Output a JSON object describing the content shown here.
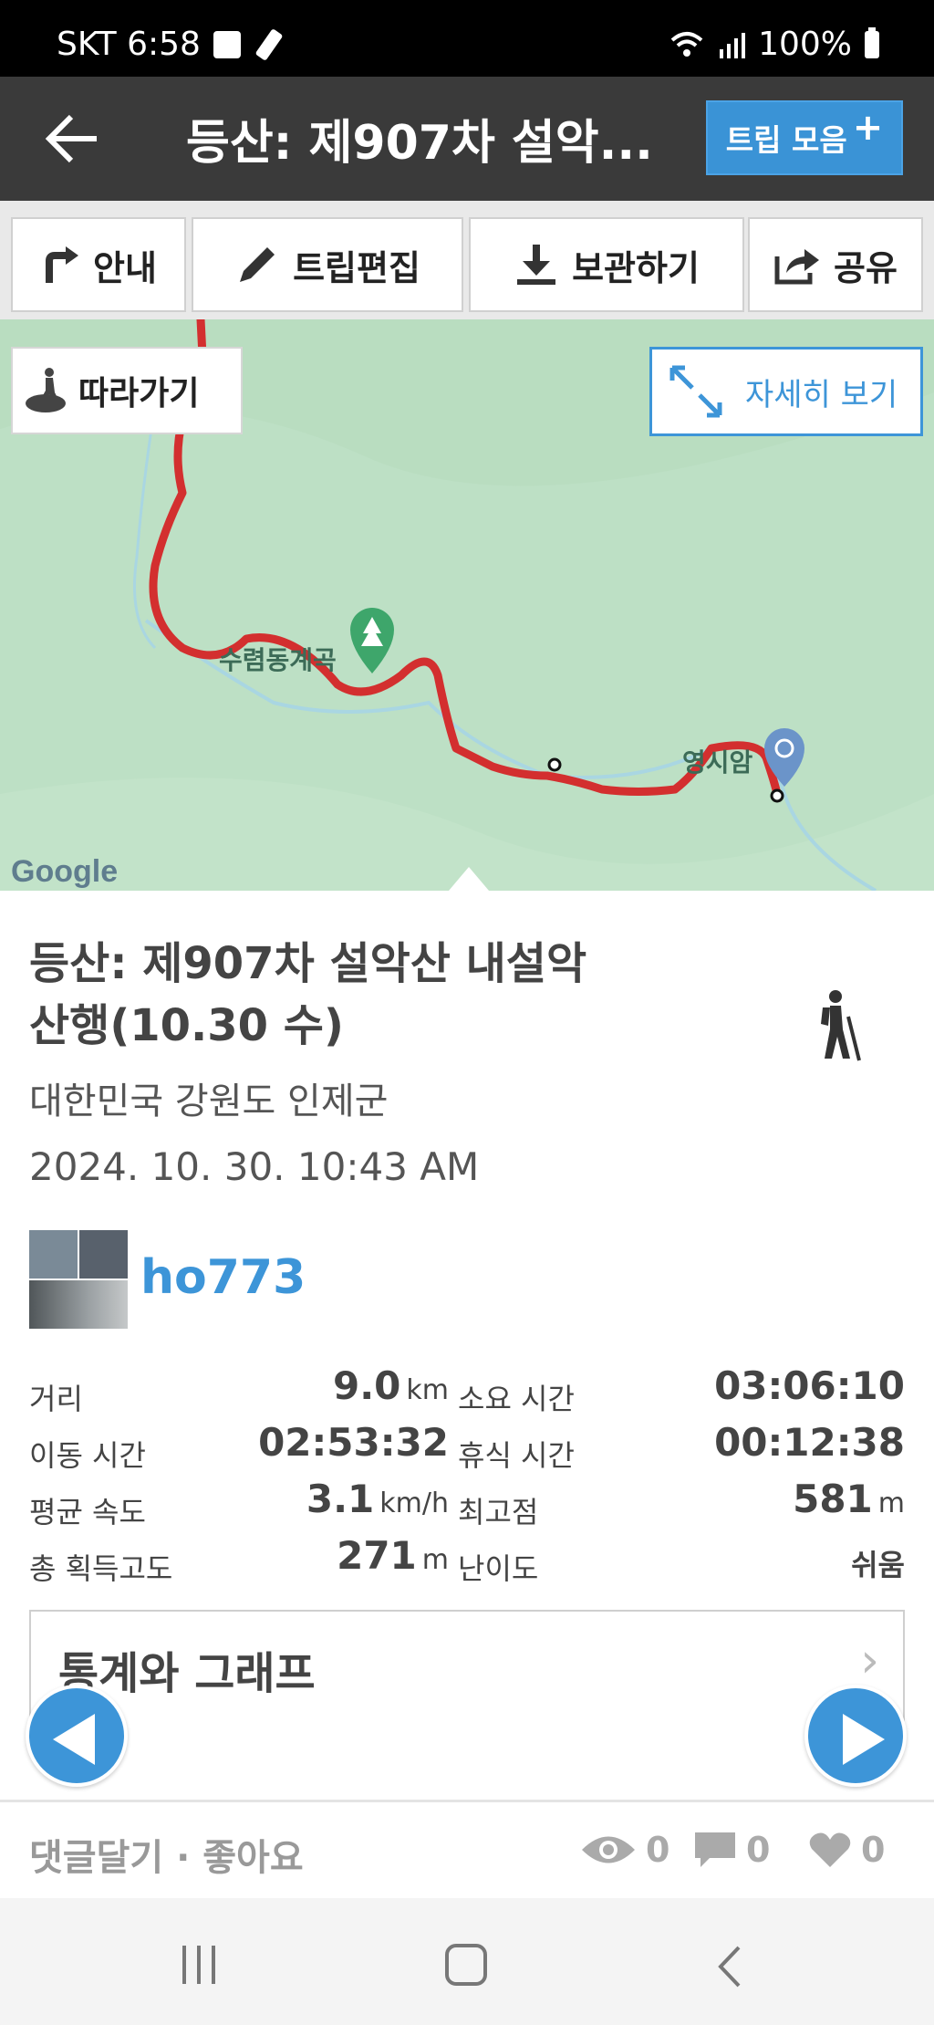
{
  "status_bar": {
    "carrier_time": "SKT 6:58",
    "battery": "100%"
  },
  "header": {
    "title": "등산: 제907차 설악...",
    "trip_button": "트립 모음",
    "trip_plus": "+"
  },
  "toolbar": {
    "guide": "안내",
    "edit": "트립편집",
    "save": "보관하기",
    "share": "공유"
  },
  "map": {
    "follow_button": "따라가기",
    "detail_button": "자세히 보기",
    "labels": {
      "valley": "수렴동계곡",
      "temple": "영시암"
    },
    "google": "Google",
    "route_color": "#d32f2f"
  },
  "trip": {
    "title_line1": "등산: 제907차 설악산 내설악",
    "title_line2": "산행(10.30 수)",
    "location": "대한민국 강원도 인제군",
    "datetime": "2024. 10. 30. 10:43 AM",
    "username": "ho773"
  },
  "stats": {
    "distance_label": "거리",
    "distance_value": "9.0",
    "distance_unit": "km",
    "duration_label": "소요 시간",
    "duration_value": "03:06:10",
    "moving_label": "이동 시간",
    "moving_value": "02:53:32",
    "rest_label": "휴식 시간",
    "rest_value": "00:12:38",
    "speed_label": "평균 속도",
    "speed_value": "3.1",
    "speed_unit": "km/h",
    "max_alt_label": "최고점",
    "max_alt_value": "581",
    "max_alt_unit": "m",
    "gain_label": "총 획득고도",
    "gain_value": "271",
    "gain_unit": "m",
    "difficulty_label": "난이도",
    "difficulty_value": "쉬움"
  },
  "stats_graph": {
    "label": "통계와 그래프",
    "chevron": "›"
  },
  "bottom": {
    "comment_like": "댓글달기 · 좋아요",
    "views": "0",
    "comments": "0",
    "likes": "0"
  },
  "colors": {
    "header_bg": "#3a3a3a",
    "accent": "#3d95d8",
    "map_bg": "#bde0c5"
  }
}
